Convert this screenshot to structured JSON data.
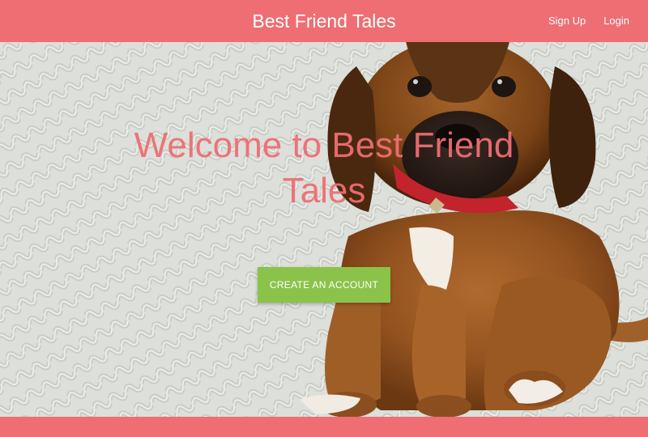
{
  "header": {
    "brand": "Best Friend Tales",
    "links": [
      {
        "label": "Sign Up"
      },
      {
        "label": "Login"
      }
    ]
  },
  "hero": {
    "title": "Welcome to Best Friend Tales",
    "cta_label": "CREATE AN ACCOUNT",
    "image_subject": "puppy-on-carpet"
  },
  "colors": {
    "brand": "#ee6e73",
    "cta": "#8bc34a",
    "text_on_brand": "#ffffff"
  }
}
